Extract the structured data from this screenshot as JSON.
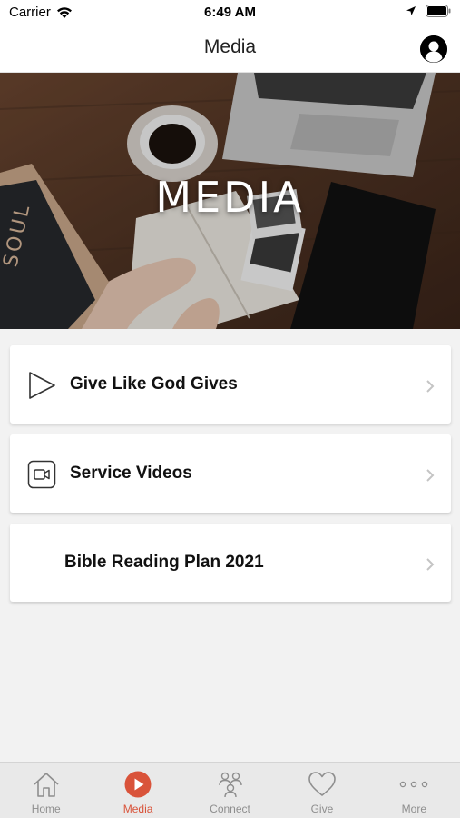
{
  "status_bar": {
    "carrier": "Carrier",
    "time": "6:49 AM"
  },
  "nav": {
    "title": "Media",
    "profile_icon": "person-circle-icon"
  },
  "hero": {
    "title": "MEDIA",
    "book_text": "SOUL"
  },
  "items": [
    {
      "label": "Give Like God Gives",
      "icon": "play-outline-icon"
    },
    {
      "label": "Service Videos",
      "icon": "video-camera-icon"
    },
    {
      "label": "Bible Reading Plan 2021",
      "icon": ""
    }
  ],
  "tabs": [
    {
      "label": "Home",
      "icon": "home-icon",
      "active": false
    },
    {
      "label": "Media",
      "icon": "play-circle-icon",
      "active": true
    },
    {
      "label": "Connect",
      "icon": "people-icon",
      "active": false
    },
    {
      "label": "Give",
      "icon": "heart-icon",
      "active": false
    },
    {
      "label": "More",
      "icon": "more-dots-icon",
      "active": false
    }
  ],
  "colors": {
    "accent": "#d9533a",
    "tab_inactive": "#8e8e8e",
    "background": "#f2f2f2"
  }
}
